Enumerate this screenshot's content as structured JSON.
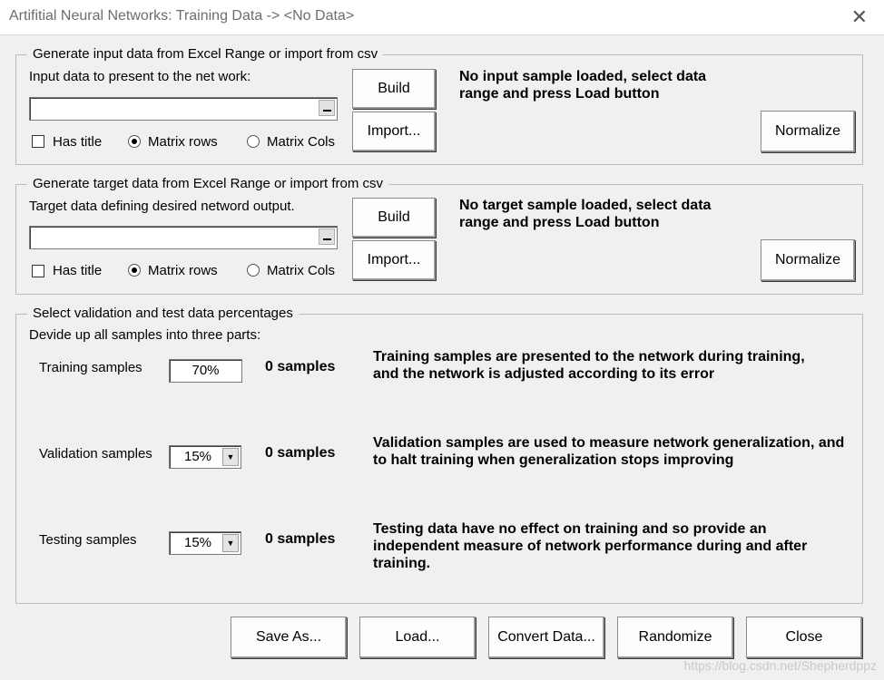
{
  "window": {
    "title": "Artifitial Neural Networks: Training Data -> <No Data>",
    "close_glyph": "✕"
  },
  "input_group": {
    "legend": "Generate input data from Excel Range or import from csv",
    "prompt": "Input data to present to the net work:",
    "range_value": "",
    "build_label": "Build",
    "import_label": "Import...",
    "has_title_label": "Has title",
    "has_title_checked": false,
    "matrix_rows_label": "Matrix rows",
    "matrix_cols_label": "Matrix Cols",
    "selected_mode": "Matrix rows",
    "status": "No input sample loaded, select data range and press Load button",
    "normalize_label": "Normalize"
  },
  "target_group": {
    "legend": "Generate target data from Excel Range or import from csv",
    "prompt": "Target data defining desired netword output.",
    "range_value": "",
    "build_label": "Build",
    "import_label": "Import...",
    "has_title_label": "Has title",
    "has_title_checked": false,
    "matrix_rows_label": "Matrix rows",
    "matrix_cols_label": "Matrix Cols",
    "selected_mode": "Matrix rows",
    "status": "No target sample loaded, select data range and press Load button",
    "normalize_label": "Normalize"
  },
  "split_group": {
    "legend": "Select validation and test data percentages",
    "prompt": "Devide up all samples into three parts:",
    "training": {
      "label": "Training samples",
      "value": "70%",
      "count": "0 samples",
      "description": "Training samples are presented to the network during training, and the network is adjusted according to its error"
    },
    "validation": {
      "label": "Validation samples",
      "value": "15%",
      "count": "0 samples",
      "description": "Validation samples are used to measure network generalization, and to halt training when generalization stops improving"
    },
    "testing": {
      "label": "Testing samples",
      "value": "15%",
      "count": "0 samples",
      "description": "Testing data have no effect on training and so provide an independent measure of network performance during and after training."
    }
  },
  "footer": {
    "save_as_label": "Save As...",
    "load_label": "Load...",
    "convert_label": "Convert Data...",
    "randomize_label": "Randomize",
    "close_label": "Close",
    "watermark": "https://blog.csdn.net/Shepherdppz"
  },
  "icons": {
    "close": "close-icon",
    "dropdown": "chevron-down-icon"
  }
}
